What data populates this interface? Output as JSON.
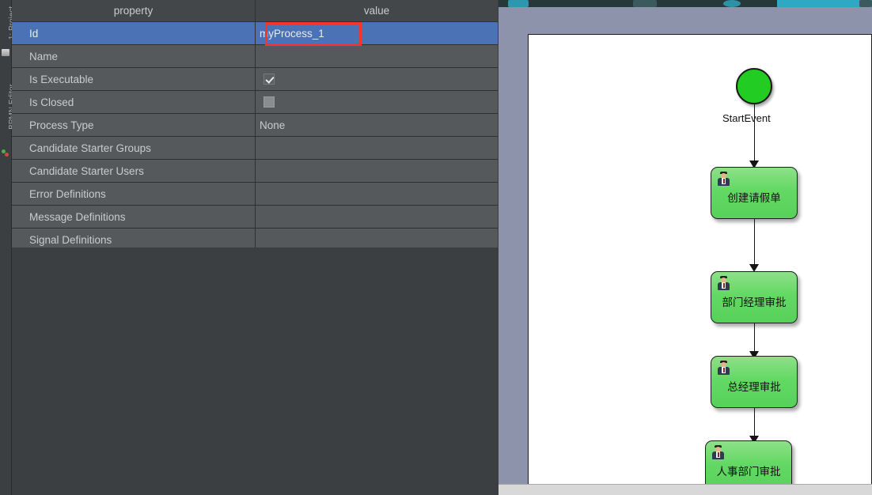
{
  "sidebar": {
    "tabs": [
      {
        "label": "1: Project",
        "icon": "project-icon"
      },
      {
        "label": "BPMN Editor",
        "icon": "bpmn-icon"
      }
    ]
  },
  "properties_panel": {
    "columns": [
      "property",
      "value"
    ],
    "rows": [
      {
        "name": "Id",
        "value": "myProcess_1",
        "type": "text",
        "selected": true,
        "expandable": false,
        "annotated": true
      },
      {
        "name": "Name",
        "value": "",
        "type": "text",
        "selected": false,
        "expandable": false,
        "annotated": false
      },
      {
        "name": "Is Executable",
        "value": "",
        "type": "checkbox",
        "checked": true,
        "selected": false,
        "expandable": false,
        "annotated": false
      },
      {
        "name": "Is Closed",
        "value": "",
        "type": "checkbox",
        "checked": false,
        "selected": false,
        "expandable": false,
        "annotated": false
      },
      {
        "name": "Process Type",
        "value": "None",
        "type": "text",
        "selected": false,
        "expandable": false,
        "annotated": false
      },
      {
        "name": "Candidate Starter Groups",
        "value": "",
        "type": "text",
        "selected": false,
        "expandable": false,
        "annotated": false
      },
      {
        "name": "Candidate Starter Users",
        "value": "",
        "type": "text",
        "selected": false,
        "expandable": false,
        "annotated": false
      },
      {
        "name": "Error Definitions",
        "value": "",
        "type": "group",
        "selected": false,
        "expandable": true,
        "annotated": false
      },
      {
        "name": "Message Definitions",
        "value": "",
        "type": "group",
        "selected": false,
        "expandable": true,
        "annotated": false
      },
      {
        "name": "Signal Definitions",
        "value": "",
        "type": "group",
        "selected": false,
        "expandable": true,
        "annotated": false
      }
    ]
  },
  "diagram": {
    "start_event": {
      "label": "StartEvent",
      "shape": "circle",
      "color": "#22cc22"
    },
    "tasks": [
      {
        "label": "创建请假单",
        "icon": "user-task-icon"
      },
      {
        "label": "部门经理审批",
        "icon": "user-task-icon"
      },
      {
        "label": "总经理审批",
        "icon": "user-task-icon"
      },
      {
        "label": "人事部门审批",
        "icon": "user-task-icon"
      }
    ],
    "canvas_background": "#8d93ab",
    "paper_background": "#ffffff",
    "task_color": "#63d964"
  },
  "annotation": {
    "color": "#f5342a",
    "target": "myProcess_1"
  }
}
